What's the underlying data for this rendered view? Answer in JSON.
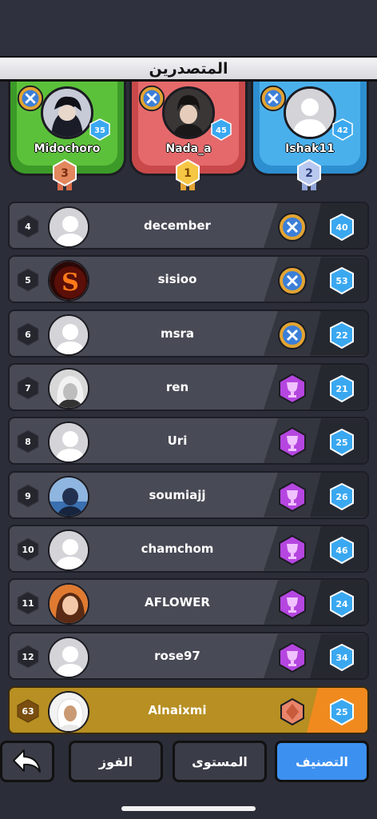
{
  "header": {
    "title": "المتصدرين"
  },
  "podium": [
    {
      "name": "Midochoro",
      "level": "35",
      "rank": "3",
      "color": "#5cc13a"
    },
    {
      "name": "Nada_a",
      "level": "45",
      "rank": "1",
      "color": "#e5696a"
    },
    {
      "name": "Ishak11",
      "level": "42",
      "rank": "2",
      "color": "#4ab0ec"
    }
  ],
  "rows": [
    {
      "rank": "4",
      "name": "december",
      "level": "40",
      "emblem": "star-emblem-icon"
    },
    {
      "rank": "5",
      "name": "sisioo",
      "level": "53",
      "emblem": "star-emblem-icon"
    },
    {
      "rank": "6",
      "name": "msra",
      "level": "22",
      "emblem": "star-emblem-icon"
    },
    {
      "rank": "7",
      "name": "ren",
      "level": "21",
      "emblem": "trophy-badge-icon"
    },
    {
      "rank": "8",
      "name": "Uri",
      "level": "25",
      "emblem": "trophy-badge-icon"
    },
    {
      "rank": "9",
      "name": "soumiajj",
      "level": "26",
      "emblem": "trophy-badge-icon"
    },
    {
      "rank": "10",
      "name": "chamchom",
      "level": "46",
      "emblem": "trophy-badge-icon"
    },
    {
      "rank": "11",
      "name": "AFLOWER",
      "level": "24",
      "emblem": "trophy-badge-icon"
    },
    {
      "rank": "12",
      "name": "rose97",
      "level": "34",
      "emblem": "trophy-badge-icon"
    }
  ],
  "me": {
    "rank": "63",
    "name": "Alnaixmi",
    "level": "25",
    "emblem": "bronze-badge-icon"
  },
  "nav": {
    "wins": "الفوز",
    "level": "المستوى",
    "ranking": "التصنيف"
  },
  "colors": {
    "accent": "#3c90f0",
    "gold": "#b78f22",
    "orange": "#f08a1f"
  }
}
